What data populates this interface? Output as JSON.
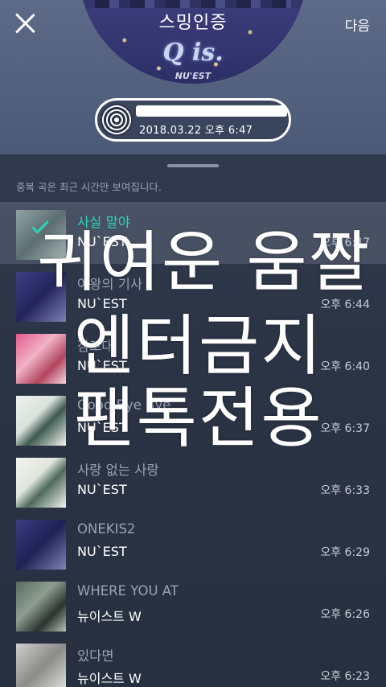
{
  "header": {
    "close_icon": "close-icon",
    "next_label": "다음",
    "cover_title": "스밍인증",
    "cover_logo": "Q is.",
    "cover_brand": "NU'EST",
    "cert_date": "2018.03.22 오후 6:47"
  },
  "notice": "중복 곡은 최근 시간만 보여집니다.",
  "songs": [
    {
      "title": "사실 말야",
      "artist": "NU`EST",
      "time": "오후 6:47",
      "active": true
    },
    {
      "title": "여왕의 기사",
      "artist": "NU`EST",
      "time": "오후 6:44"
    },
    {
      "title": "잠꼬대",
      "artist": "NU`EST",
      "time": "오후 6:40"
    },
    {
      "title": "Good Bye Bye",
      "artist": "NU`EST",
      "time": "오후 6:37"
    },
    {
      "title": "사랑 없는 사랑",
      "artist": "NU`EST",
      "time": "오후 6:33"
    },
    {
      "title": "ONEKIS2",
      "artist": "NU`EST",
      "time": "오후 6:29"
    },
    {
      "title": "WHERE YOU AT",
      "artist": "뉴이스트 W",
      "time": "오후 6:26"
    },
    {
      "title": "있다면",
      "artist": "뉴이스트 W",
      "time": "오후 6:23"
    }
  ],
  "overlay": {
    "line1": "귀여운 움짤",
    "line2": "엔터금지",
    "line3": "팬톡전용"
  },
  "colors": {
    "accent": "#2bd6b4",
    "background": "#2b3446"
  }
}
